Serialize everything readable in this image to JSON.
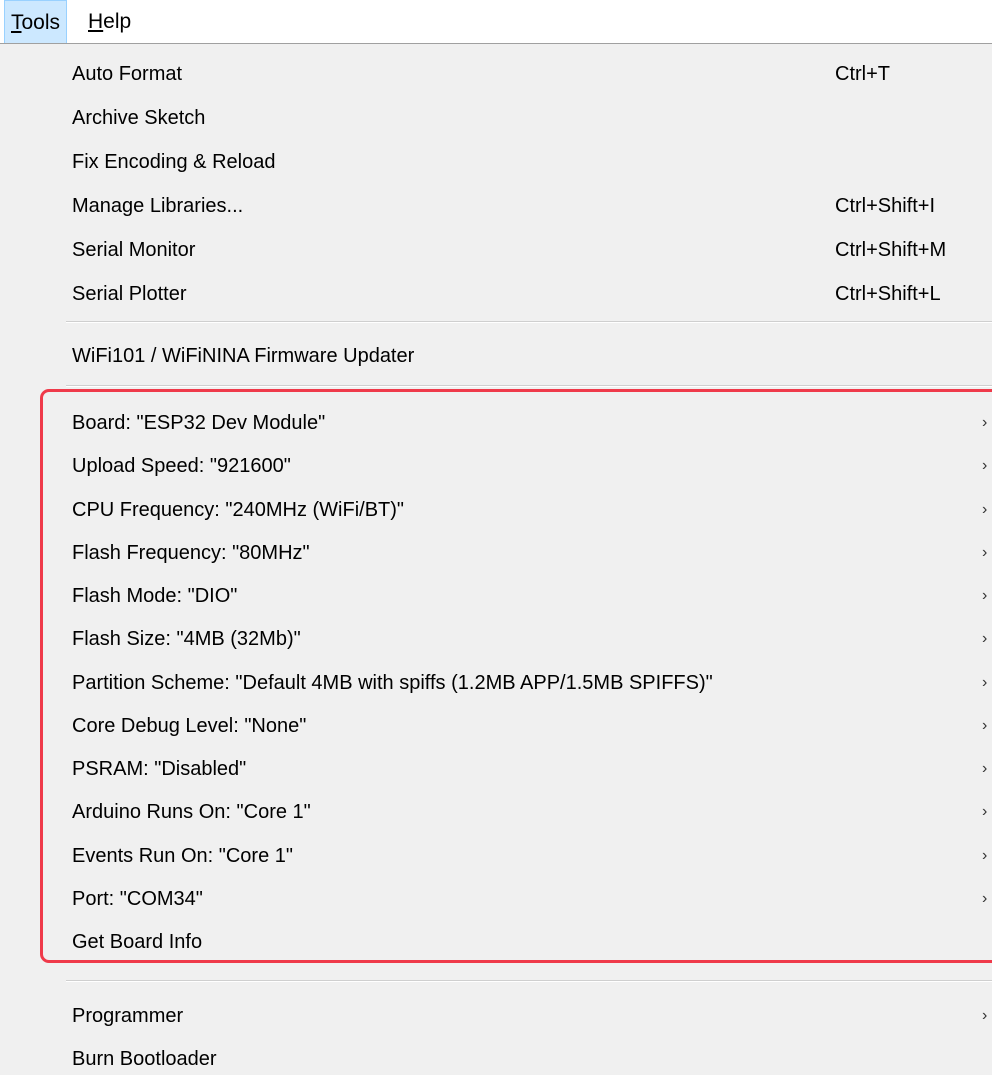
{
  "menubar": {
    "tools_label": "Tools",
    "help_label": "Help"
  },
  "highlight_color": "#ef3a4a",
  "menu": {
    "auto_format": {
      "label": "Auto Format",
      "shortcut": "Ctrl+T"
    },
    "archive_sketch": {
      "label": "Archive Sketch"
    },
    "fix_encoding": {
      "label": "Fix Encoding & Reload"
    },
    "manage_libraries": {
      "label": "Manage Libraries...",
      "shortcut": "Ctrl+Shift+I"
    },
    "serial_monitor": {
      "label": "Serial Monitor",
      "shortcut": "Ctrl+Shift+M"
    },
    "serial_plotter": {
      "label": "Serial Plotter",
      "shortcut": "Ctrl+Shift+L"
    },
    "firmware_updater": {
      "label": "WiFi101 / WiFiNINA Firmware Updater"
    },
    "board": {
      "label": "Board: \"ESP32 Dev Module\""
    },
    "upload_speed": {
      "label": "Upload Speed: \"921600\""
    },
    "cpu_frequency": {
      "label": "CPU Frequency: \"240MHz (WiFi/BT)\""
    },
    "flash_frequency": {
      "label": "Flash Frequency: \"80MHz\""
    },
    "flash_mode": {
      "label": "Flash Mode: \"DIO\""
    },
    "flash_size": {
      "label": "Flash Size: \"4MB (32Mb)\""
    },
    "partition_scheme": {
      "label": "Partition Scheme: \"Default 4MB with spiffs (1.2MB APP/1.5MB SPIFFS)\""
    },
    "core_debug_level": {
      "label": "Core Debug Level: \"None\""
    },
    "psram": {
      "label": "PSRAM: \"Disabled\""
    },
    "arduino_runs_on": {
      "label": "Arduino Runs On: \"Core 1\""
    },
    "events_run_on": {
      "label": "Events Run On: \"Core 1\""
    },
    "port": {
      "label": "Port: \"COM34\""
    },
    "get_board_info": {
      "label": "Get Board Info"
    },
    "programmer": {
      "label": "Programmer"
    },
    "burn_bootloader": {
      "label": "Burn Bootloader"
    },
    "submenu_arrow": "›"
  }
}
